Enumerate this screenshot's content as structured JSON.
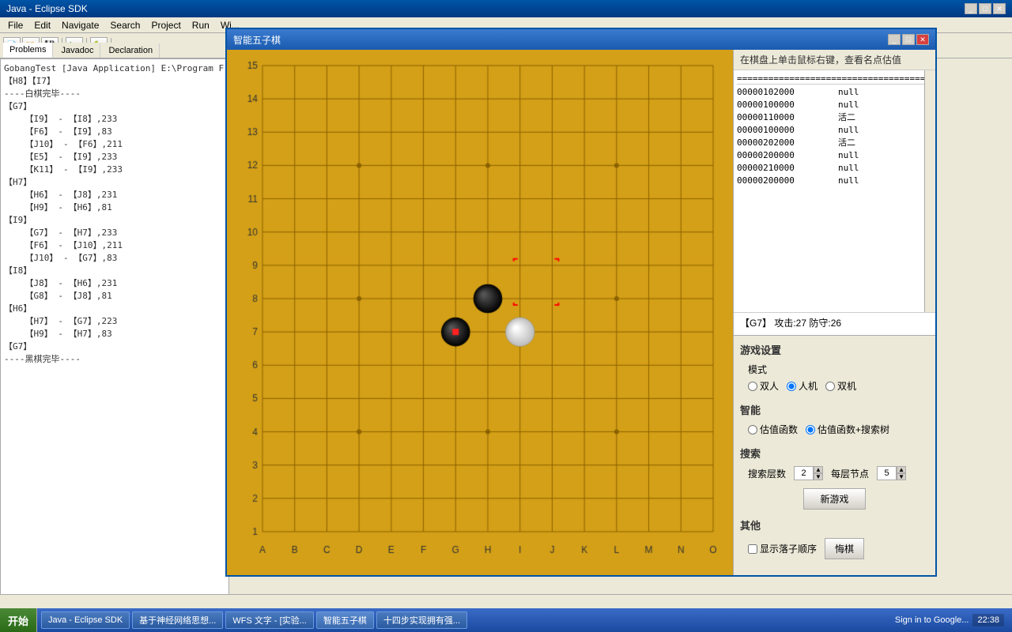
{
  "eclipse": {
    "title": "Java - Eclipse SDK",
    "menu": [
      "File",
      "Edit",
      "Navigate",
      "Search",
      "Project",
      "Run",
      "Wi..."
    ],
    "tabs": [
      "Problems",
      "Javadoc",
      "Declaration"
    ]
  },
  "console": {
    "header": "GobangTest [Java Application] E:\\Program F",
    "lines": [
      "【H8】【I7】",
      "----白棋完毕----",
      "【G7】",
      "    【I9】 - 【I8】,233",
      "    【F6】 - 【I9】,83",
      "    【J10】 - 【F6】,211",
      "    【E5】 - 【I9】,233",
      "    【K11】 - 【I9】,233",
      "【H7】",
      "    【H6】 - 【J8】,231",
      "    【H9】 - 【H6】,81",
      "【I9】",
      "    【G7】 - 【H7】,233",
      "    【F6】 - 【J10】,211",
      "    【J10】 - 【G7】,83",
      "【I8】",
      "    【J8】 - 【H6】,231",
      "    【G8】 - 【J8】,81",
      "【H6】",
      "    【H7】 - 【G7】,223",
      "    【H9】 - 【H7】,83",
      "【G7】",
      "----黑棋完毕----"
    ]
  },
  "game": {
    "title": "智能五子棋",
    "header_hint": "在棋盘上单击鼠标右键，查看名点估值",
    "info_separator": "============================================",
    "info_rows": [
      {
        "code": "00000102000",
        "value": "null"
      },
      {
        "code": "00000100000",
        "value": "null"
      },
      {
        "code": "00000110000",
        "value": "活二"
      },
      {
        "code": "00000100000",
        "value": "null"
      },
      {
        "code": "",
        "value": ""
      },
      {
        "code": "00000202000",
        "value": "活二"
      },
      {
        "code": "00000200000",
        "value": "null"
      },
      {
        "code": "00000210000",
        "value": "null"
      },
      {
        "code": "00000200000",
        "value": "null"
      }
    ],
    "score_text": "【G7】 攻击:27 防守:26",
    "board": {
      "cols": [
        "A",
        "B",
        "C",
        "D",
        "E",
        "F",
        "G",
        "H",
        "I",
        "J",
        "K",
        "L",
        "M",
        "N",
        "O"
      ],
      "rows": [
        "15",
        "14",
        "13",
        "12",
        "11",
        "10",
        "9",
        "8",
        "7",
        "6",
        "5",
        "4",
        "3",
        "2",
        "1"
      ],
      "black_stones": [
        {
          "col": 7,
          "row": 7
        }
      ],
      "white_stones": [
        {
          "col": 8,
          "row": 7
        }
      ],
      "last_black": {
        "col": 6,
        "row": 6
      },
      "cursor_squares": [
        {
          "col": 8,
          "row": 9
        },
        {
          "col": 9,
          "row": 9
        },
        {
          "col": 8,
          "row": 8
        },
        {
          "col": 9,
          "row": 8
        }
      ]
    },
    "settings": {
      "title": "游戏设置",
      "mode_label": "模式",
      "modes": [
        "双人",
        "人机",
        "双机"
      ],
      "mode_selected": "人机",
      "ai_label": "智能",
      "ai_options": [
        "估值函数",
        "估值函数+搜索树"
      ],
      "ai_selected": "估值函数+搜索树",
      "search_label": "搜索",
      "search_depth_label": "搜索层数",
      "search_depth_value": "2",
      "nodes_label": "每层节点",
      "nodes_value": "5",
      "new_game_label": "新游戏",
      "other_label": "其他",
      "show_order_label": "显示落子顺序",
      "undo_label": "悔棋"
    }
  },
  "taskbar": {
    "start": "开始",
    "items": [
      {
        "label": "Java - Eclipse SDK",
        "active": false
      },
      {
        "label": "基于神经网络思想...",
        "active": false
      },
      {
        "label": "WFS 文字 - [实验...",
        "active": false
      },
      {
        "label": "智能五子棋",
        "active": true
      },
      {
        "label": "十四步实现拥有强...",
        "active": false
      }
    ],
    "time": "22:38"
  },
  "statusbar": {
    "text": ""
  }
}
